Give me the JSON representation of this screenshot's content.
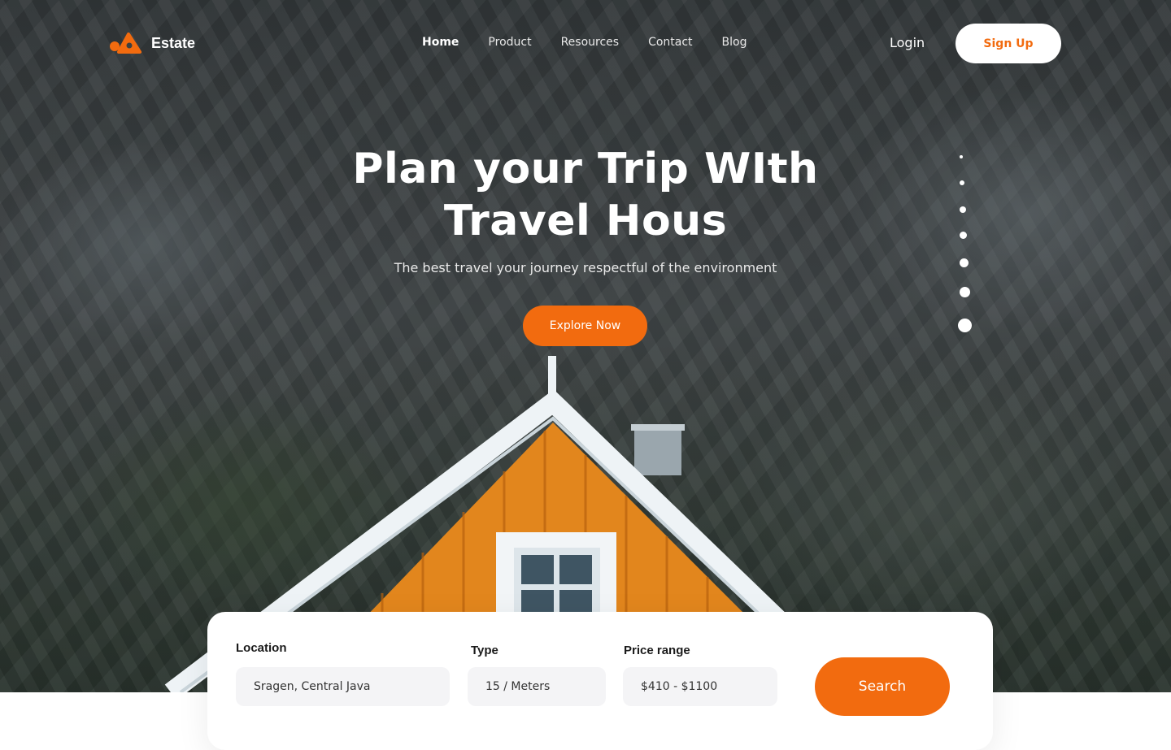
{
  "brand": {
    "name": "Estate",
    "accent": "#f26b0f"
  },
  "nav": {
    "items": [
      {
        "label": "Home"
      },
      {
        "label": "Product"
      },
      {
        "label": "Resources"
      },
      {
        "label": "Contact"
      },
      {
        "label": "Blog"
      }
    ]
  },
  "auth": {
    "login_label": "Login",
    "signup_label": "Sign Up"
  },
  "hero": {
    "title_line1": "Plan your Trip WIth",
    "title_line2": "Travel Hous",
    "subtitle": "The best travel your journey respectful of the environment",
    "cta_label": "Explore Now"
  },
  "pager": {
    "count": 7,
    "active_index": 6
  },
  "search": {
    "location_label": "Location",
    "location_value": "Sragen, Central Java",
    "type_label": "Type",
    "type_value": "15 / Meters",
    "price_label": "Price range",
    "price_value": "$410 - $1100",
    "button_label": "Search"
  }
}
